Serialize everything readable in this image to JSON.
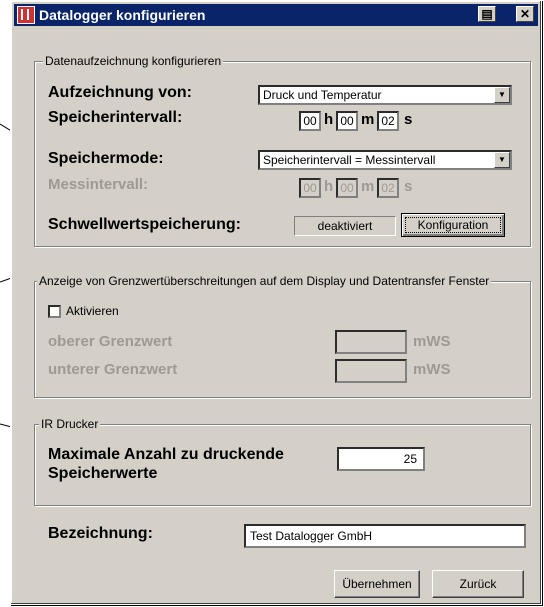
{
  "window": {
    "title": "Datalogger konfigurieren"
  },
  "group_record": {
    "title": "Datenaufzeichnung konfigurieren",
    "aufzeichnung_label": "Aufzeichnung von:",
    "aufzeichnung_value": "Druck und Temperatur",
    "speicherintervall_label": "Speicherintervall:",
    "speicherintervall": {
      "h": "00",
      "m": "00",
      "s": "02"
    },
    "speichermode_label": "Speichermode:",
    "speichermode_value": "Speicherintervall = Messintervall",
    "messintervall_label": "Messintervall:",
    "messintervall": {
      "h": "00",
      "m": "00",
      "s": "02"
    },
    "schwell_label": "Schwellwertspeicherung:",
    "schwell_status": "deaktiviert",
    "konfiguration_button": "Konfiguration"
  },
  "units": {
    "h": "h",
    "m": "m",
    "s": "s",
    "mws": "mWS"
  },
  "group_limits": {
    "title": "Anzeige von Grenzwertüberschreitungen auf dem Display und Datentransfer Fenster",
    "aktivieren_label": "Aktivieren",
    "oberer_label": "oberer Grenzwert",
    "oberer_value": "",
    "unterer_label": "unterer Grenzwert",
    "unterer_value": ""
  },
  "group_printer": {
    "title": "IR Drucker",
    "max_label_line1": "Maximale Anzahl zu druckende",
    "max_label_line2": "Speicherwerte",
    "max_value": "25"
  },
  "bezeichnung": {
    "label": "Bezeichnung:",
    "value": "Test Datalogger GmbH"
  },
  "buttons": {
    "apply": "Übernehmen",
    "back": "Zurück"
  }
}
